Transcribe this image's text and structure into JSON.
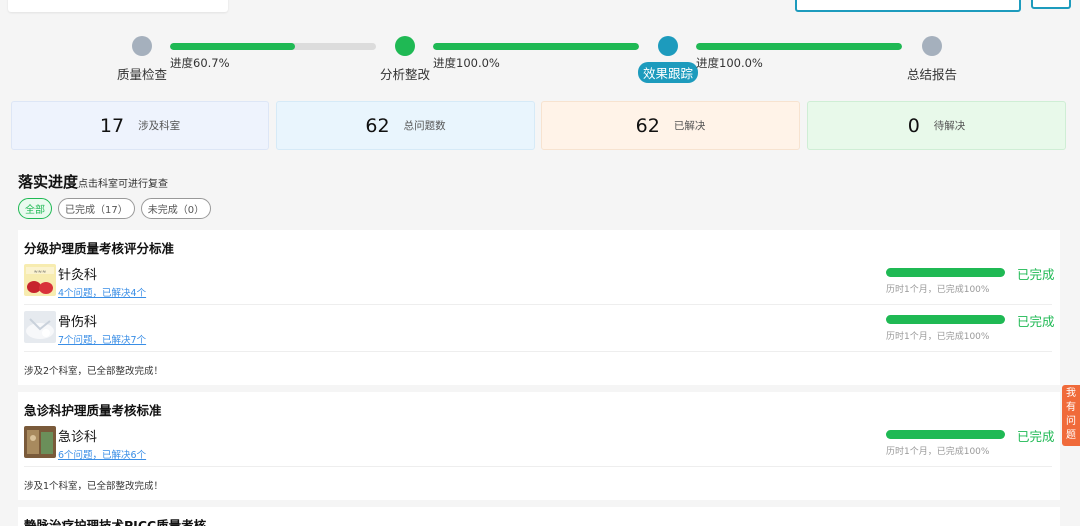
{
  "steps": [
    {
      "label": "质量检查",
      "color": "#a5b0bd",
      "active": false
    },
    {
      "label": "分析整改",
      "color": "#1fb954",
      "active": false
    },
    {
      "label": "效果跟踪",
      "color": "#1d9bbd",
      "active": true
    },
    {
      "label": "总结报告",
      "color": "#a5b0bd",
      "active": false
    }
  ],
  "connectors": [
    {
      "label": "进度60.7%",
      "progress": 0.607
    },
    {
      "label": "进度100.0%",
      "progress": 1.0
    },
    {
      "label": "进度100.0%",
      "progress": 1.0
    }
  ],
  "stats": [
    {
      "value": "17",
      "label": "涉及科室",
      "bg": "#eef3fd",
      "border": "#dde6f6"
    },
    {
      "value": "62",
      "label": "总问题数",
      "bg": "#e9f5fd",
      "border": "#d6eaf7"
    },
    {
      "value": "62",
      "label": "已解决",
      "bg": "#fff3e8",
      "border": "#f7e3d0"
    },
    {
      "value": "0",
      "label": "待解决",
      "bg": "#e8f9ea",
      "border": "#cfeed5"
    }
  ],
  "section": {
    "title": "落实进度",
    "hint": "点击科室可进行复查"
  },
  "filters": [
    {
      "label": "全部",
      "active": true
    },
    {
      "label": "已完成（17）",
      "active": false
    },
    {
      "label": "未完成（0）",
      "active": false
    }
  ],
  "panels": [
    {
      "title": "分级护理质量考核评分标准",
      "rows": [
        {
          "dept": "针灸科",
          "link": "4个问题，已解决4个",
          "sub": "历时1个月，已完成100%",
          "status": "已完成",
          "progress": 1.0,
          "thumb": "acupuncture-thumbnail"
        },
        {
          "dept": "骨伤科",
          "link": "7个问题，已解决7个",
          "sub": "历时1个月，已完成100%",
          "status": "已完成",
          "progress": 1.0,
          "thumb": "orthopedics-thumbnail"
        }
      ],
      "footer": "涉及2个科室，已全部整改完成！"
    },
    {
      "title": "急诊科护理质量考核标准",
      "rows": [
        {
          "dept": "急诊科",
          "link": "6个问题，已解决6个",
          "sub": "历时1个月，已完成100%",
          "status": "已完成",
          "progress": 1.0,
          "thumb": "emergency-thumbnail"
        }
      ],
      "footer": "涉及1个科室，已全部整改完成！"
    },
    {
      "title": "静脉治疗护理技术PICC质量考核",
      "rows": [],
      "footer": ""
    }
  ],
  "side_tab": {
    "label": "我有问题"
  }
}
